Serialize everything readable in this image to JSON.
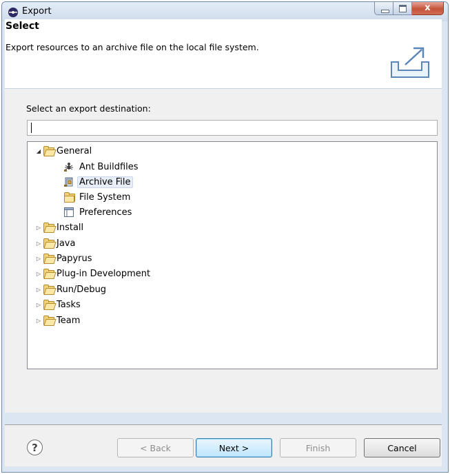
{
  "window": {
    "title": "Export",
    "close_glyph": "x"
  },
  "header": {
    "title": "Select",
    "description": "Export resources to an archive file on the local file system."
  },
  "destination": {
    "label": "Select an export destination:",
    "filter_value": ""
  },
  "tree": {
    "expanded": {
      "label": "General",
      "children": [
        {
          "label": "Ant Buildfiles",
          "icon": "ant-icon"
        },
        {
          "label": "Archive File",
          "icon": "archive-file-icon",
          "selected": true
        },
        {
          "label": "File System",
          "icon": "file-system-icon"
        },
        {
          "label": "Preferences",
          "icon": "preferences-icon"
        }
      ]
    },
    "collapsed": [
      "Install",
      "Java",
      "Papyrus",
      "Plug-in Development",
      "Run/Debug",
      "Tasks",
      "Team"
    ]
  },
  "buttons": {
    "help": "?",
    "back": "< Back",
    "next": "Next >",
    "finish": "Finish",
    "cancel": "Cancel"
  },
  "colors": {
    "window_frame": "#dbe6f2",
    "selection": "#e8eef7",
    "folder": "#f2d279"
  }
}
